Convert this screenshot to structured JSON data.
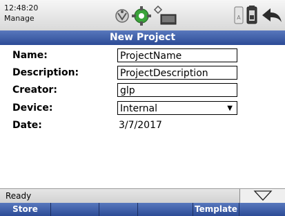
{
  "header": {
    "time": "12:48:20",
    "mode": "Manage",
    "icons": [
      "network-icon",
      "gps-icon",
      "signal-icon",
      "battery-icon",
      "sd-card-icon",
      "back-icon"
    ]
  },
  "title": "New Project",
  "form": {
    "name_label": "Name:",
    "name_value": "ProjectName",
    "description_label": "Description:",
    "description_value": "ProjectDescription",
    "creator_label": "Creator:",
    "creator_value": "glp",
    "device_label": "Device:",
    "device_value": "Internal",
    "date_label": "Date:",
    "date_value": "3/7/2017"
  },
  "status": {
    "text": "Ready"
  },
  "softkeys": [
    {
      "label": "Store"
    },
    {
      "label": ""
    },
    {
      "label": ""
    },
    {
      "label": ""
    },
    {
      "label": "Template"
    },
    {
      "label": ""
    }
  ],
  "colors": {
    "accent": "#2c4b96",
    "accent_light": "#5878bd",
    "gps_green": "#2e9a2e"
  }
}
